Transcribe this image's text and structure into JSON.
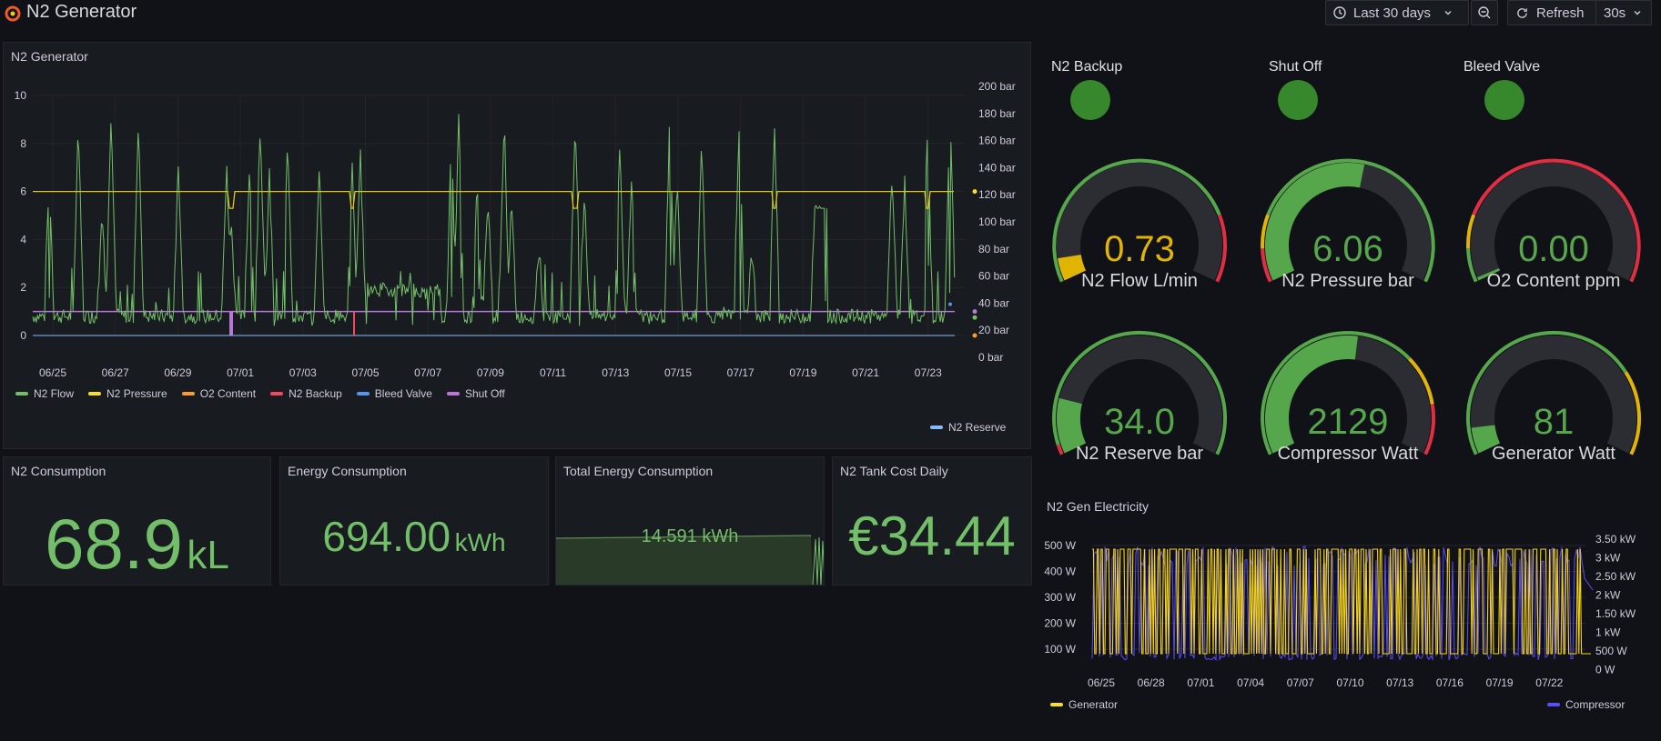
{
  "header": {
    "title": "N2 Generator",
    "time_range": "Last 30 days",
    "refresh_label": "Refresh",
    "refresh_interval": "30s"
  },
  "main_chart": {
    "title": "N2 Generator",
    "left_ticks": [
      "10",
      "8",
      "6",
      "4",
      "2",
      "0"
    ],
    "right_ticks": [
      "200 bar",
      "180 bar",
      "160 bar",
      "140 bar",
      "120 bar",
      "100 bar",
      "80 bar",
      "60 bar",
      "40 bar",
      "20 bar",
      "0 bar"
    ],
    "x_ticks": [
      "06/25",
      "06/27",
      "06/29",
      "07/01",
      "07/03",
      "07/05",
      "07/07",
      "07/09",
      "07/11",
      "07/13",
      "07/15",
      "07/17",
      "07/19",
      "07/21",
      "07/23"
    ],
    "legend": [
      {
        "name": "N2 Flow",
        "color": "#73bf69"
      },
      {
        "name": "N2 Pressure",
        "color": "#fade2a"
      },
      {
        "name": "O2 Content",
        "color": "#ff9830"
      },
      {
        "name": "N2 Backup",
        "color": "#f2495c"
      },
      {
        "name": "Bleed Valve",
        "color": "#5794f2"
      },
      {
        "name": "Shut Off",
        "color": "#b877d9"
      }
    ],
    "legend_right": {
      "name": "N2 Reserve",
      "color": "#8ab8ff"
    }
  },
  "chart_data": [
    {
      "type": "line",
      "title": "N2 Generator",
      "x": [
        "06/25",
        "06/27",
        "06/29",
        "07/01",
        "07/03",
        "07/05",
        "07/07",
        "07/09",
        "07/11",
        "07/13",
        "07/15",
        "07/17",
        "07/19",
        "07/21",
        "07/23"
      ],
      "series": [
        {
          "name": "N2 Flow",
          "values": [
            2.5,
            8.5,
            8.5,
            1.5,
            1.5,
            7.5,
            8.5,
            7.5,
            7.0,
            7.0,
            8.5,
            8.0,
            5.5,
            6.0,
            9.0
          ]
        },
        {
          "name": "N2 Pressure",
          "values": [
            6,
            6,
            6,
            6,
            6,
            6,
            6,
            6,
            6,
            6,
            6,
            6,
            6,
            6,
            6
          ]
        },
        {
          "name": "Shut Off",
          "values": [
            1,
            1,
            1,
            1,
            1,
            1,
            1,
            1,
            1,
            1,
            1,
            1,
            1,
            1,
            1
          ]
        }
      ],
      "ylim": [
        0,
        10
      ],
      "y2lim": [
        "0 bar",
        "200 bar"
      ]
    },
    {
      "type": "line",
      "title": "N2 Gen Electricity",
      "x": [
        "06/25",
        "06/28",
        "07/01",
        "07/04",
        "07/07",
        "07/10",
        "07/13",
        "07/16",
        "07/19",
        "07/22"
      ],
      "series": [
        {
          "name": "Generator",
          "values": [
            480,
            480,
            480,
            480,
            480,
            480,
            480,
            480,
            480,
            480
          ]
        },
        {
          "name": "Compressor",
          "values": [
            2.8,
            2.8,
            2.8,
            2.8,
            2.8,
            2.8,
            2.8,
            2.8,
            2.8,
            2.8
          ]
        }
      ],
      "left_ticks": [
        "500 W",
        "400 W",
        "300 W",
        "200 W",
        "100 W"
      ],
      "right_ticks": [
        "3.50 kW",
        "3 kW",
        "2.50 kW",
        "2 kW",
        "1.50 kW",
        "1 kW",
        "500 W",
        "0 W"
      ]
    }
  ],
  "stats": {
    "n2_consumption": {
      "title": "N2 Consumption",
      "value": "68.9",
      "unit": "kL"
    },
    "energy": {
      "title": "Energy Consumption",
      "value": "694.00",
      "unit": "kWh"
    },
    "total_energy": {
      "title": "Total Energy Consumption",
      "value": "14.591 kWh"
    },
    "tank_cost": {
      "title": "N2 Tank Cost Daily",
      "value": "€34.44"
    }
  },
  "status": [
    {
      "label": "N2 Backup"
    },
    {
      "label": "Shut Off"
    },
    {
      "label": "Bleed Valve"
    }
  ],
  "gauges": [
    {
      "value": "0.73",
      "label": "N2 Flow L/min",
      "fraction": 0.07,
      "color": "#e0b400"
    },
    {
      "value": "6.06",
      "label": "N2 Pressure bar",
      "fraction": 0.55,
      "color": "#56a64b"
    },
    {
      "value": "0.00",
      "label": "O2 Content ppm",
      "fraction": 0.0,
      "color": "#56a64b"
    },
    {
      "value": "34.0",
      "label": "N2 Reserve bar",
      "fraction": 0.17,
      "color": "#56a64b"
    },
    {
      "value": "2129",
      "label": "Compressor Watt",
      "fraction": 0.53,
      "color": "#56a64b"
    },
    {
      "value": "81",
      "label": "Generator Watt",
      "fraction": 0.08,
      "color": "#56a64b"
    }
  ],
  "electricity": {
    "title": "N2 Gen Electricity",
    "legend": [
      {
        "name": "Generator",
        "color": "#fade2a"
      },
      {
        "name": "Compressor",
        "color": "#5a4fff"
      }
    ]
  }
}
